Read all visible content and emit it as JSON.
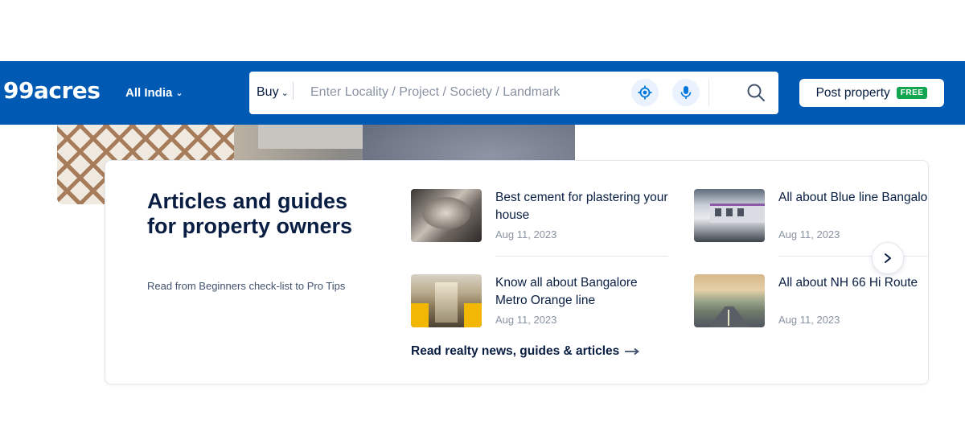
{
  "header": {
    "logo": "99acres",
    "city_selector": "All India",
    "search": {
      "mode": "Buy",
      "placeholder": "Enter Locality / Project / Society / Landmark"
    },
    "post_property": {
      "label": "Post property",
      "badge": "FREE"
    }
  },
  "articles_section": {
    "title": "Articles and guides for property owners",
    "subtitle": "Read from Beginners check-list to Pro Tips",
    "articles": [
      {
        "title": "Best cement for plastering your house",
        "date": "Aug 11, 2023"
      },
      {
        "title": "All about Blue line Bangalore",
        "date": "Aug 11, 2023"
      },
      {
        "title": "Know all about Bangalore Metro Orange line",
        "date": "Aug 11, 2023"
      },
      {
        "title": "All about NH 66 Hi Route",
        "date": "Aug 11, 2023"
      }
    ],
    "read_more": "Read realty news, guides & articles"
  },
  "colors": {
    "brand": "#0059b2",
    "free_badge": "#12a650",
    "text_primary": "#091e42",
    "text_muted": "#8993a4"
  }
}
